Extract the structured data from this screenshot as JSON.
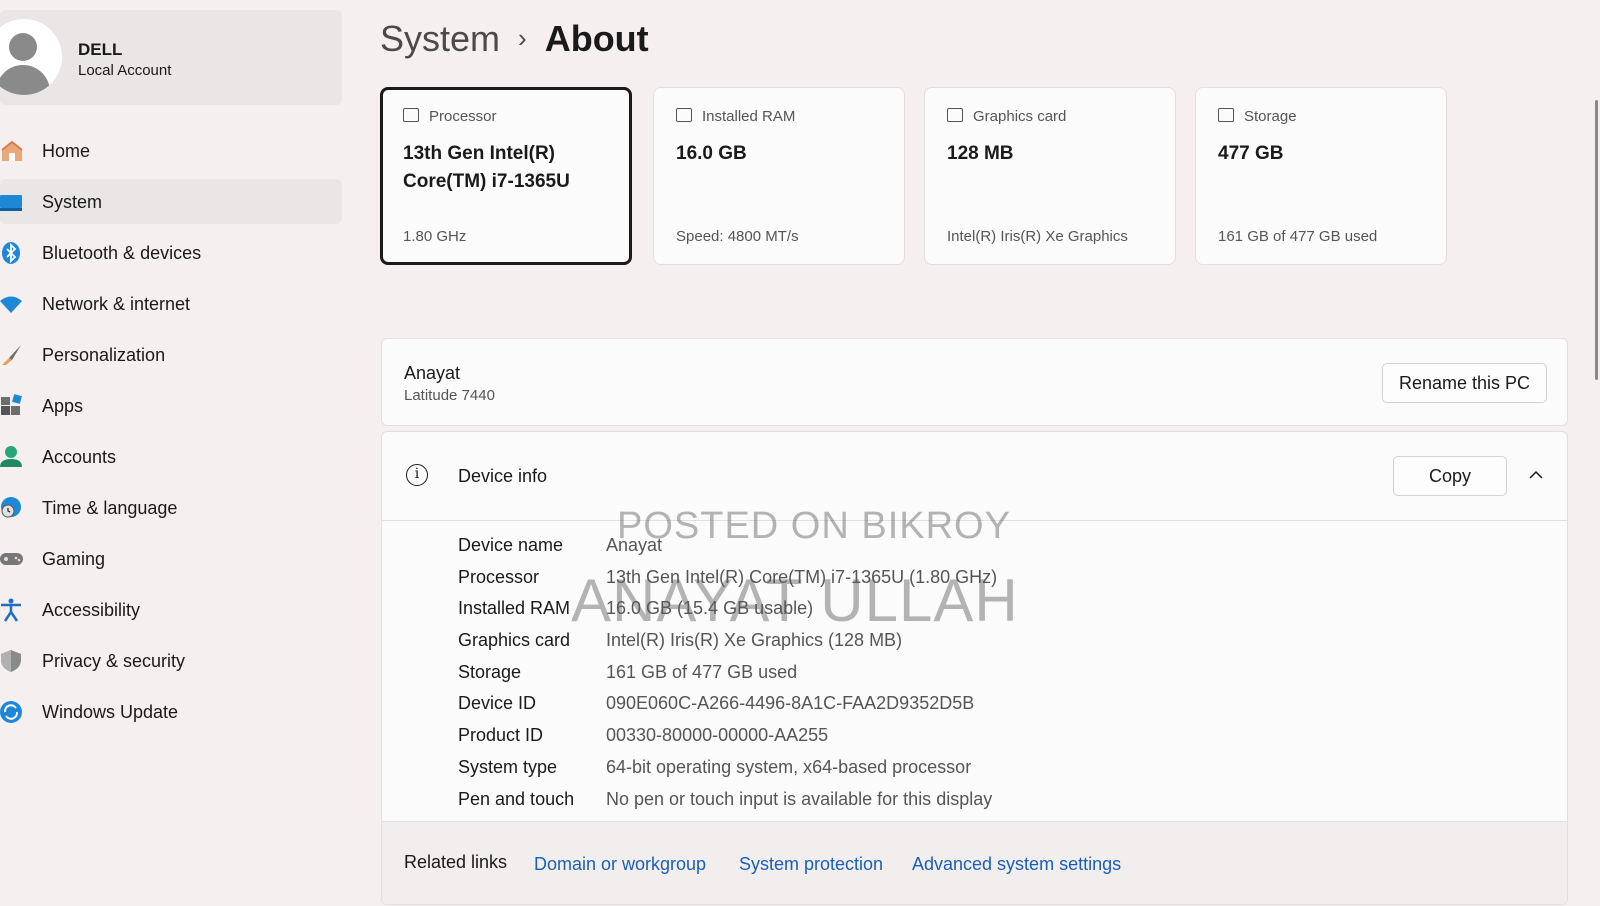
{
  "profile": {
    "name": "DELL",
    "account_type": "Local Account"
  },
  "sidebar": {
    "items": [
      {
        "label": "Home",
        "icon": "home-icon"
      },
      {
        "label": "System",
        "icon": "system-icon",
        "active": true
      },
      {
        "label": "Bluetooth & devices",
        "icon": "bluetooth-icon"
      },
      {
        "label": "Network & internet",
        "icon": "wifi-icon"
      },
      {
        "label": "Personalization",
        "icon": "brush-icon"
      },
      {
        "label": "Apps",
        "icon": "apps-icon"
      },
      {
        "label": "Accounts",
        "icon": "accounts-icon"
      },
      {
        "label": "Time & language",
        "icon": "globe-clock-icon"
      },
      {
        "label": "Gaming",
        "icon": "gamepad-icon"
      },
      {
        "label": "Accessibility",
        "icon": "accessibility-icon"
      },
      {
        "label": "Privacy & security",
        "icon": "shield-icon"
      },
      {
        "label": "Windows Update",
        "icon": "update-icon"
      }
    ]
  },
  "breadcrumb": {
    "parent": "System",
    "separator": "›",
    "current": "About"
  },
  "specs": [
    {
      "heading": "Processor",
      "value": "13th Gen Intel(R) Core(TM) i7-1365U",
      "sub": "1.80 GHz",
      "icon": "processor-icon"
    },
    {
      "heading": "Installed RAM",
      "value": "16.0 GB",
      "sub": "Speed: 4800 MT/s",
      "icon": "ram-icon"
    },
    {
      "heading": "Graphics card",
      "value": "128 MB",
      "sub": "Intel(R) Iris(R) Xe Graphics",
      "icon": "graphics-card-icon"
    },
    {
      "heading": "Storage",
      "value": "477 GB",
      "sub": "161 GB of 477 GB used",
      "icon": "storage-icon"
    }
  ],
  "pc": {
    "name": "Anayat",
    "model": "Latitude 7440",
    "rename_label": "Rename this PC"
  },
  "device_info": {
    "title": "Device info",
    "copy_label": "Copy",
    "rows": [
      {
        "key": "Device name",
        "value": "Anayat"
      },
      {
        "key": "Processor",
        "value": "13th Gen Intel(R) Core(TM) i7-1365U (1.80 GHz)"
      },
      {
        "key": "Installed RAM",
        "value": "16.0 GB (15.4 GB usable)"
      },
      {
        "key": "Graphics card",
        "value": "Intel(R) Iris(R) Xe Graphics (128 MB)"
      },
      {
        "key": "Storage",
        "value": "161 GB of 477 GB used"
      },
      {
        "key": "Device ID",
        "value": "090E060C-A266-4496-8A1C-FAA2D9352D5B"
      },
      {
        "key": "Product ID",
        "value": "00330-80000-00000-AA255"
      },
      {
        "key": "System type",
        "value": "64-bit operating system, x64-based processor"
      },
      {
        "key": "Pen and touch",
        "value": "No pen or touch input is available for this display"
      }
    ]
  },
  "related": {
    "label": "Related links",
    "links": [
      "Domain or workgroup",
      "System protection",
      "Advanced system settings"
    ]
  },
  "watermark": {
    "line1": "POSTED ON BIKROY",
    "line2": "ANAYAT ULLAH"
  },
  "colors": {
    "accent": "#0067c0",
    "link": "#1a5fb4",
    "background": "#f5efef"
  }
}
